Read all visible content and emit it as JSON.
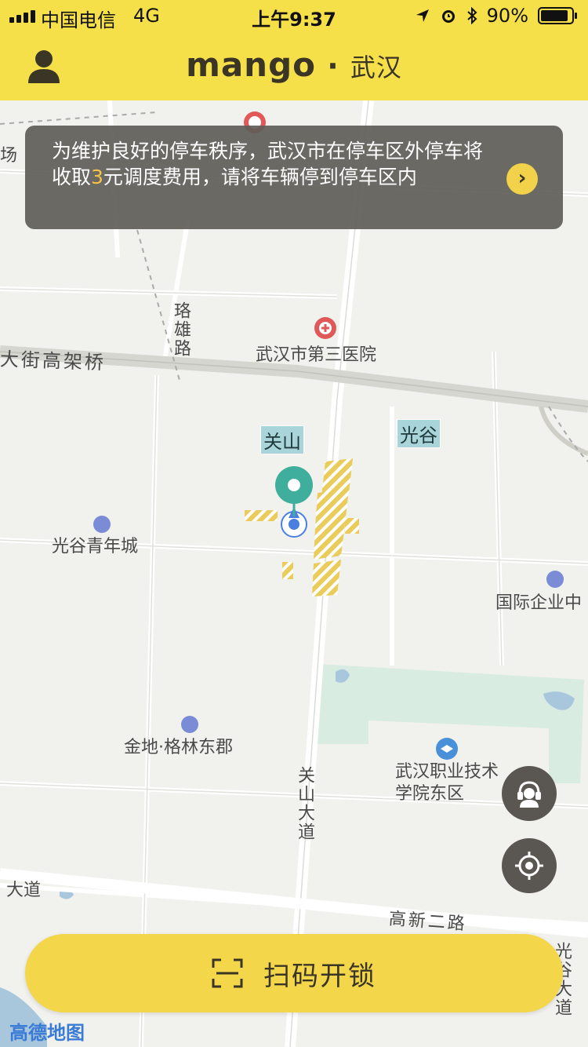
{
  "status_bar": {
    "carrier": "中国电信",
    "network": "4G",
    "time": "上午9:37",
    "battery": "90%",
    "battery_level": 0.9
  },
  "header": {
    "brand": "mango",
    "separator": "·",
    "city": "武汉"
  },
  "notice": {
    "text_part1": "为维护良好的停车秩序，武汉市在停车区外停车将收取",
    "fee": "3",
    "text_part2": "元调度费用，请将车辆停到停车区内"
  },
  "map": {
    "labels": {
      "road_top_left": "大街高架桥",
      "road_luoxiong": "珞雄路",
      "hospital": "武汉市第三医院",
      "area_guanshan": "关山",
      "area_guanggu": "光谷",
      "guanggu_youth_city": "光谷青年城",
      "international_enterprise": "国际企业中",
      "jindi_gelin": "金地·格林东郡",
      "guanshan_avenue": "关山大道",
      "vocational_college": "武汉职业技术学院东区",
      "road_dadao_left": "大道",
      "gaoxin_road": "高新二路",
      "guanggu_avenue": "光谷大道",
      "road_left_edge": "场"
    },
    "attribution": "高德地图"
  },
  "actions": {
    "scan_label": "扫码开锁"
  },
  "colors": {
    "brand_yellow": "#f6e04a",
    "button_yellow": "#f3d64a",
    "notice_bg": "#5f5d58",
    "fee_highlight": "#f6c24a",
    "fab_bg": "#5a5651",
    "location_teal": "#3fae9c",
    "parking_zone": "#e9cc5a"
  },
  "icons": {
    "user": "user-icon",
    "notice_arrow": "chevron-right-icon",
    "customer_service": "headset-icon",
    "locate": "locate-icon",
    "scan": "scan-icon"
  }
}
